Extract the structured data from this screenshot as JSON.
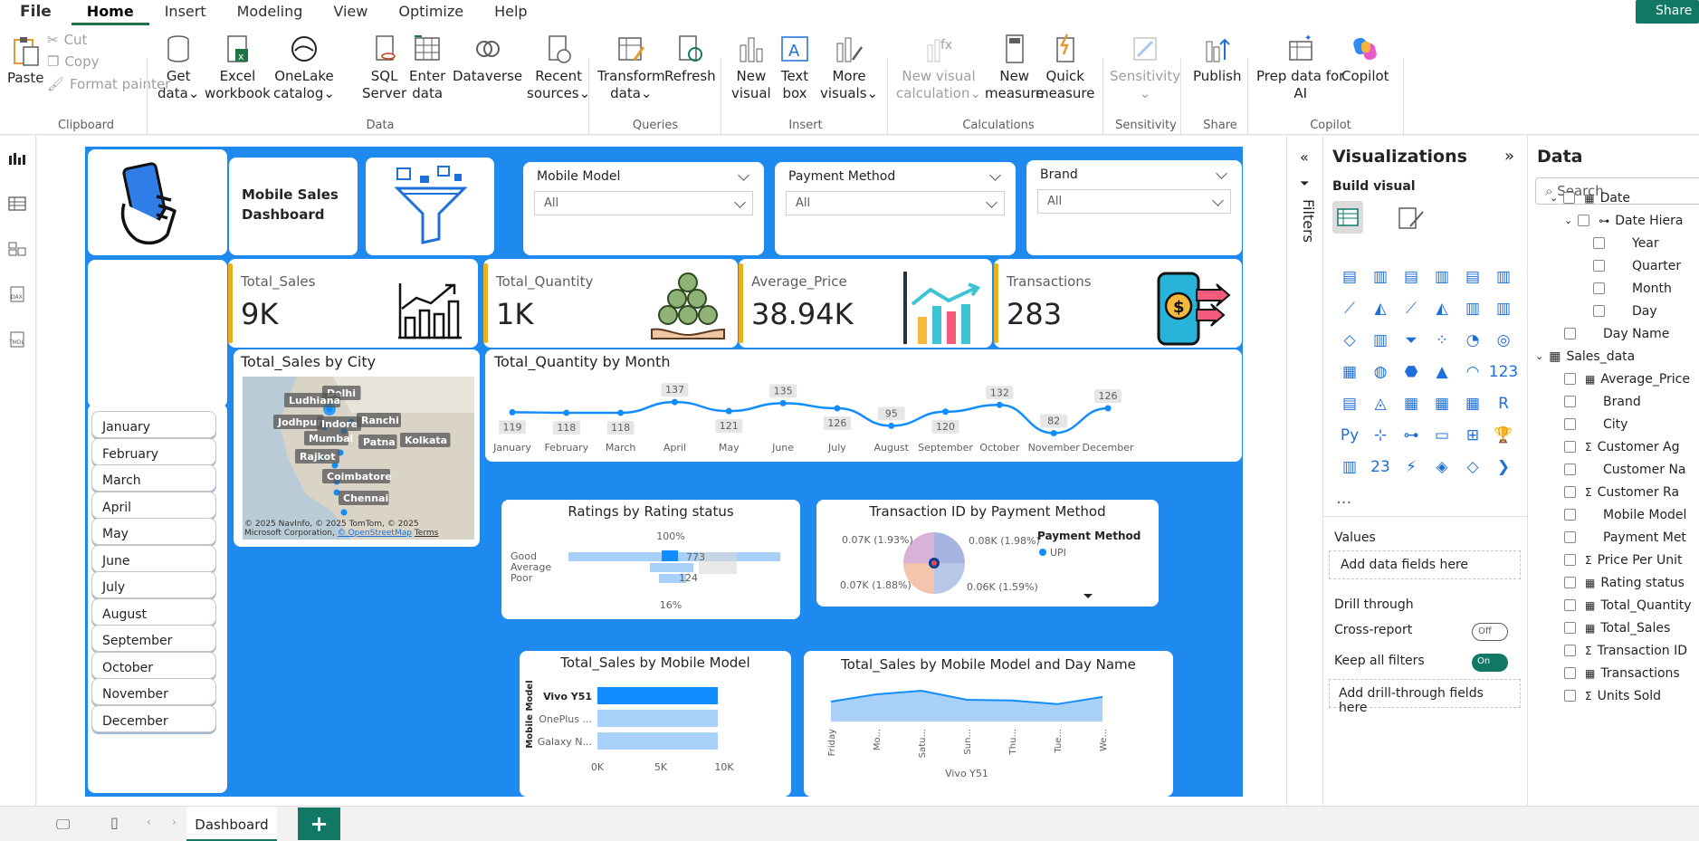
{
  "menu": {
    "items": [
      "File",
      "Home",
      "Insert",
      "Modeling",
      "View",
      "Optimize",
      "Help"
    ],
    "share": "Share"
  },
  "ribbon": {
    "paste": "Paste",
    "cut": "Cut",
    "copy": "Copy",
    "format_painter": "Format painter",
    "get_data": [
      "Get",
      "data"
    ],
    "excel": [
      "Excel",
      "workbook"
    ],
    "onelake": [
      "OneLake",
      "catalog"
    ],
    "sql": [
      "SQL",
      "Server"
    ],
    "enter_data": [
      "Enter",
      "data"
    ],
    "dataverse": "Dataverse",
    "recent": [
      "Recent",
      "sources"
    ],
    "transform": [
      "Transform",
      "data"
    ],
    "refresh": "Refresh",
    "new_visual": [
      "New",
      "visual"
    ],
    "text_box": [
      "Text",
      "box"
    ],
    "more_visuals": [
      "More",
      "visuals"
    ],
    "new_visual_calc": [
      "New visual",
      "calculation"
    ],
    "new_measure": [
      "New",
      "measure"
    ],
    "quick_measure": [
      "Quick",
      "measure"
    ],
    "sensitivity": "Sensitivity",
    "publish": "Publish",
    "prep_data": [
      "Prep data for",
      "AI"
    ],
    "copilot": "Copilot",
    "groups": {
      "clipboard": "Clipboard",
      "data": "Data",
      "queries": "Queries",
      "insert": "Insert",
      "calculations": "Calculations",
      "sensitivity": "Sensitivity",
      "share": "Share",
      "copilot": "Copilot"
    }
  },
  "report": {
    "title": [
      "Mobile Sales",
      "Dashboard"
    ],
    "slicers": [
      {
        "label": "Mobile Model",
        "value": "All"
      },
      {
        "label": "Payment Method",
        "value": "All"
      },
      {
        "label": "Brand",
        "value": "All"
      }
    ],
    "kpis": [
      {
        "label": "Total_Sales",
        "value": "9K"
      },
      {
        "label": "Total_Quantity",
        "value": "1K"
      },
      {
        "label": "Average_Price",
        "value": "38.94K"
      },
      {
        "label": "Transactions",
        "value": "283"
      }
    ],
    "months": [
      "January",
      "February",
      "March",
      "April",
      "May",
      "June",
      "July",
      "August",
      "September",
      "October",
      "November",
      "December"
    ],
    "map": {
      "title": "Total_Sales by City",
      "cities": [
        "Delhi",
        "Ludhiana",
        "Jodhpur",
        "Indore",
        "Ranchi",
        "Mumbai",
        "Patna",
        "Kolkata",
        "Rajkot",
        "Coimbatore",
        "Chennai"
      ],
      "attribution": "© 2025 NavInfo, © 2025 TomTom, © 2025 Microsoft Corporation,",
      "osm": "© OpenStreetMap",
      "terms": "Terms"
    },
    "ratings": {
      "title": "Ratings by Rating status",
      "categories": [
        "Good",
        "Average",
        "Poor"
      ],
      "top": "100%",
      "bottom": "16%",
      "l1": "773",
      "l2": "124"
    },
    "payment": {
      "title": "Transaction ID by Payment Method",
      "legend_title": "Payment Method",
      "legend_item": "UPI",
      "labels": [
        "0.07K (1.93%)",
        "0.08K (1.98%)",
        "0.07K (1.88%)",
        "0.06K (1.59%)"
      ]
    },
    "model_bar": {
      "title": "Total_Sales by Mobile Model",
      "ylabel": "Mobile Model",
      "ticks": [
        "0K",
        "5K",
        "10K"
      ]
    },
    "model_day": {
      "title": "Total_Sales by Mobile Model and Day Name",
      "xlabel": "Vivo Y51",
      "days": [
        "Friday",
        "Mo...",
        "Satu...",
        "Sun...",
        "Thu...",
        "Tue...",
        "We..."
      ]
    }
  },
  "chart_data": [
    {
      "type": "line",
      "title": "Total_Quantity by Month",
      "categories": [
        "January",
        "February",
        "March",
        "April",
        "May",
        "June",
        "July",
        "August",
        "September",
        "October",
        "November",
        "December"
      ],
      "values": [
        119,
        118,
        118,
        137,
        121,
        135,
        126,
        95,
        120,
        132,
        82,
        126
      ]
    },
    {
      "type": "bar",
      "title": "Total_Sales by Mobile Model",
      "categories": [
        "Vivo Y51",
        "OnePlus ...",
        "Galaxy N..."
      ],
      "values": [
        9500,
        9500,
        9500
      ],
      "ylabel": "Mobile Model",
      "xlim": [
        0,
        10000
      ]
    },
    {
      "type": "area",
      "title": "Total_Sales by Mobile Model and Day Name",
      "categories": [
        "Friday",
        "Mo...",
        "Satu...",
        "Sun...",
        "Thu...",
        "Tue...",
        "We..."
      ],
      "values": [
        0.55,
        0.75,
        0.85,
        0.6,
        0.58,
        0.48,
        0.68
      ]
    }
  ],
  "visualizations": {
    "title": "Visualizations",
    "build": "Build visual",
    "values": "Values",
    "add_fields": "Add data fields here",
    "drill": "Drill through",
    "cross": "Cross-report",
    "cross_state": "Off",
    "keep": "Keep all filters",
    "keep_state": "On",
    "add_drill": "Add drill-through fields here",
    "more": "..."
  },
  "filters": "Filters",
  "data_pane": {
    "title": "Data",
    "search": "Search",
    "fields": [
      {
        "label": "Date",
        "indent": 40,
        "icon": "table"
      },
      {
        "label": "Date Hiera",
        "indent": 56,
        "icon": "hier"
      },
      {
        "label": "Year",
        "indent": 88,
        "icon": ""
      },
      {
        "label": "Quarter",
        "indent": 88,
        "icon": ""
      },
      {
        "label": "Month",
        "indent": 88,
        "icon": ""
      },
      {
        "label": "Day",
        "indent": 88,
        "icon": ""
      },
      {
        "label": "Day Name",
        "indent": 56,
        "icon": ""
      },
      {
        "label": "Sales_data",
        "indent": 24,
        "icon": "table"
      },
      {
        "label": "Average_Price",
        "indent": 56,
        "icon": "calc"
      },
      {
        "label": "Brand",
        "indent": 56,
        "icon": ""
      },
      {
        "label": "City",
        "indent": 56,
        "icon": ""
      },
      {
        "label": "Customer Ag",
        "indent": 56,
        "icon": "sigma"
      },
      {
        "label": "Customer Na",
        "indent": 56,
        "icon": ""
      },
      {
        "label": "Customer Ra",
        "indent": 56,
        "icon": "sigma"
      },
      {
        "label": "Mobile Model",
        "indent": 56,
        "icon": ""
      },
      {
        "label": "Payment Met",
        "indent": 56,
        "icon": ""
      },
      {
        "label": "Price Per Unit",
        "indent": 56,
        "icon": "sigma"
      },
      {
        "label": "Rating status",
        "indent": 56,
        "icon": "calc"
      },
      {
        "label": "Total_Quantity",
        "indent": 56,
        "icon": "calc"
      },
      {
        "label": "Total_Sales",
        "indent": 56,
        "icon": "calc"
      },
      {
        "label": "Transaction ID",
        "indent": 56,
        "icon": "sigma"
      },
      {
        "label": "Transactions",
        "indent": 56,
        "icon": "calc"
      },
      {
        "label": "Units Sold",
        "indent": 56,
        "icon": "sigma"
      }
    ]
  },
  "bottom": {
    "tab": "Dashboard",
    "add": "+"
  },
  "colors": {
    "accent": "#117865",
    "report_bg": "#1e8af0",
    "line": "#118dff",
    "kpi_bar": "#e8b01d"
  }
}
